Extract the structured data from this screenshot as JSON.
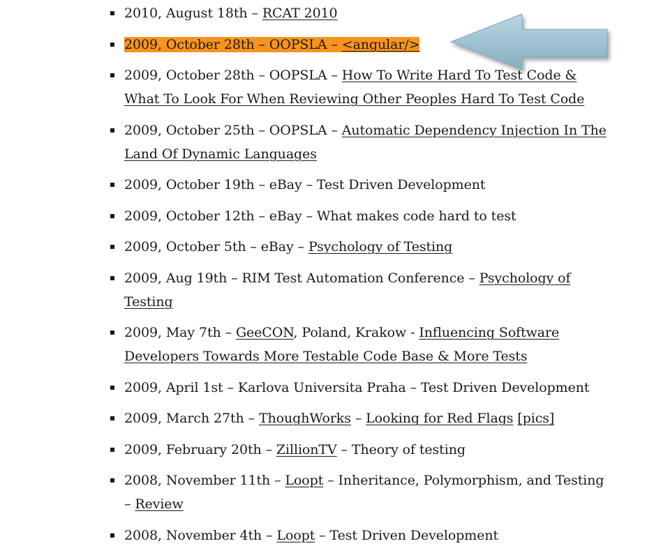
{
  "talks": [
    {
      "parts": [
        {
          "t": "2010, August 18th – "
        },
        {
          "t": "RCAT 2010",
          "link": true
        }
      ]
    },
    {
      "highlight": true,
      "parts": [
        {
          "t": "2009, October 28th – OOPSLA – "
        },
        {
          "t": "<angular/>",
          "link": true
        }
      ]
    },
    {
      "parts": [
        {
          "t": "2009, October 28th – OOPSLA – "
        },
        {
          "t": "How To Write Hard To Test Code & What To Look For When Reviewing Other Peoples Hard To Test Code",
          "link": true
        }
      ]
    },
    {
      "parts": [
        {
          "t": "2009, October 25th – OOPSLA – "
        },
        {
          "t": "Automatic Dependency Injection In The Land Of Dynamic Languages",
          "link": true
        }
      ]
    },
    {
      "parts": [
        {
          "t": "2009, October 19th – eBay – Test Driven Development"
        }
      ]
    },
    {
      "parts": [
        {
          "t": "2009, October 12th – eBay – What makes code hard to test"
        }
      ]
    },
    {
      "parts": [
        {
          "t": "2009, October 5th – eBay – "
        },
        {
          "t": "Psychology of Testing",
          "link": true
        }
      ]
    },
    {
      "parts": [
        {
          "t": "2009, Aug 19th – RIM Test Automation Conference – "
        },
        {
          "t": "Psychology of Testing",
          "link": true
        }
      ]
    },
    {
      "parts": [
        {
          "t": "2009, May 7th – "
        },
        {
          "t": "GeeCON",
          "link": true
        },
        {
          "t": ", Poland, Krakow - "
        },
        {
          "t": "Influencing Software Developers Towards More Testable Code Base & More Tests",
          "link": true
        }
      ]
    },
    {
      "parts": [
        {
          "t": "2009, April 1st – Karlova Universita Praha – Test Driven Development"
        }
      ]
    },
    {
      "parts": [
        {
          "t": "2009, March 27th – "
        },
        {
          "t": "ThoughWorks",
          "link": true
        },
        {
          "t": " – "
        },
        {
          "t": "Looking for Red Flags",
          "link": true
        },
        {
          "t": " "
        },
        {
          "t": "[pics]",
          "link": true
        }
      ]
    },
    {
      "parts": [
        {
          "t": "2009, February 20th – "
        },
        {
          "t": "ZillionTV",
          "link": true
        },
        {
          "t": " – Theory of testing"
        }
      ]
    },
    {
      "parts": [
        {
          "t": "2008, November 11th – "
        },
        {
          "t": "Loopt",
          "link": true
        },
        {
          "t": " – Inheritance, Polymorphism, and Testing – "
        },
        {
          "t": "Review",
          "link": true
        }
      ]
    },
    {
      "parts": [
        {
          "t": "2008, November 4th – "
        },
        {
          "t": "Loopt",
          "link": true
        },
        {
          "t": " – Test Driven Development"
        }
      ]
    }
  ],
  "colors": {
    "highlight": "#f7941d",
    "arrow_fill": "#9fc3d3",
    "text": "#1a1a1a"
  },
  "icons": {
    "arrow": "left-pointing-arrow-icon"
  }
}
